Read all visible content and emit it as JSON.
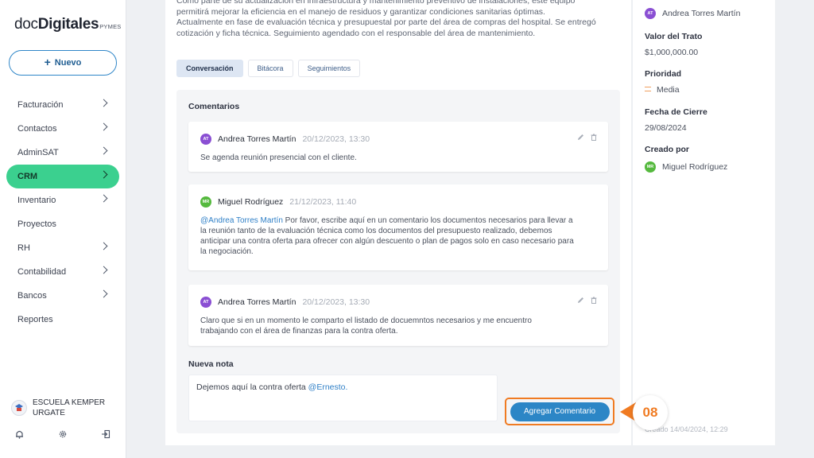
{
  "app": {
    "logo_light": "doc",
    "logo_bold": "Digitales",
    "logo_suffix": "PYMES"
  },
  "sidebar": {
    "new_button": "Nuevo",
    "items": [
      {
        "label": "Facturación",
        "chevron": true
      },
      {
        "label": "Contactos",
        "chevron": true
      },
      {
        "label": "AdminSAT",
        "chevron": true
      },
      {
        "label": "CRM",
        "chevron": true,
        "active": true
      },
      {
        "label": "Inventario",
        "chevron": true
      },
      {
        "label": "Proyectos",
        "chevron": false
      },
      {
        "label": "RH",
        "chevron": true
      },
      {
        "label": "Contabilidad",
        "chevron": true
      },
      {
        "label": "Bancos",
        "chevron": true
      },
      {
        "label": "Reportes",
        "chevron": false
      }
    ],
    "organization": "ESCUELA KEMPER URGATE",
    "footer_icons": [
      "bell-icon",
      "gear-icon",
      "logout-icon"
    ]
  },
  "deal": {
    "description_lines": [
      "Como parte de su actualización en infraestructura y mantenimiento preventivo de instalaciones, este equipo",
      "permitirá mejorar la eficiencia en el manejo de residuos y garantizar condiciones sanitarias óptimas.",
      "Actualmente en fase de evaluación técnica y presupuestal por parte del área de compras del hospital. Se entregó",
      "cotización y ficha técnica. Seguimiento agendado con el responsable del área de mantenimiento."
    ]
  },
  "tabs": [
    {
      "label": "Conversación",
      "active": true
    },
    {
      "label": "Bitácora",
      "active": false
    },
    {
      "label": "Seguimientos",
      "active": false
    }
  ],
  "comments_section": {
    "title": "Comentarios",
    "comments": [
      {
        "initials": "AT",
        "author": "Andrea Torres Martín",
        "time": "20/12/2023, 13:30",
        "mention": "",
        "text": "Se agenda reunión presencial con el cliente.",
        "editable": true
      },
      {
        "initials": "MR",
        "author": "Miguel Rodríguez",
        "time": "21/12/2023, 11:40",
        "mention": "@Andrea Torres Martín",
        "text": " Por favor, escribe aquí en un comentario los documentos necesarios para llevar a la reunión tanto de la evaluación técnica como los documentos del presupuesto realizado, debemos anticipar una contra oferta para ofrecer con algún descuento o plan de pagos solo en caso necesario para la negociación.",
        "editable": false
      },
      {
        "initials": "AT",
        "author": "Andrea Torres Martín",
        "time": "20/12/2023, 13:30",
        "mention": "",
        "text": "Claro que si en un momento le comparto el listado de docuemntos necesarios y me encuentro trabajando con el área de finanzas para  la contra oferta.",
        "editable": true
      }
    ],
    "new_note_label": "Nueva nota",
    "new_note_text": "Dejemos aquí la  contra oferta ",
    "new_note_mention": "@Ernesto.",
    "submit_label": "Agregar Comentario"
  },
  "step_badge": "08",
  "details": {
    "owner_initials": "AT",
    "owner_name": "Andrea Torres Martín",
    "value_label": "Valor del Trato",
    "value": "$1,000,000.00",
    "priority_label": "Prioridad",
    "priority": "Media",
    "close_label": "Fecha de Cierre",
    "close_date": "29/08/2024",
    "created_by_label": "Creado por",
    "created_by_initials": "MR",
    "created_by": "Miguel Rodríguez",
    "created_stamp": "Creado 14/04/2024, 12:29"
  },
  "colors": {
    "accent": "#2c86c6",
    "active_menu": "#3bd08f",
    "callout": "#f07b22"
  }
}
